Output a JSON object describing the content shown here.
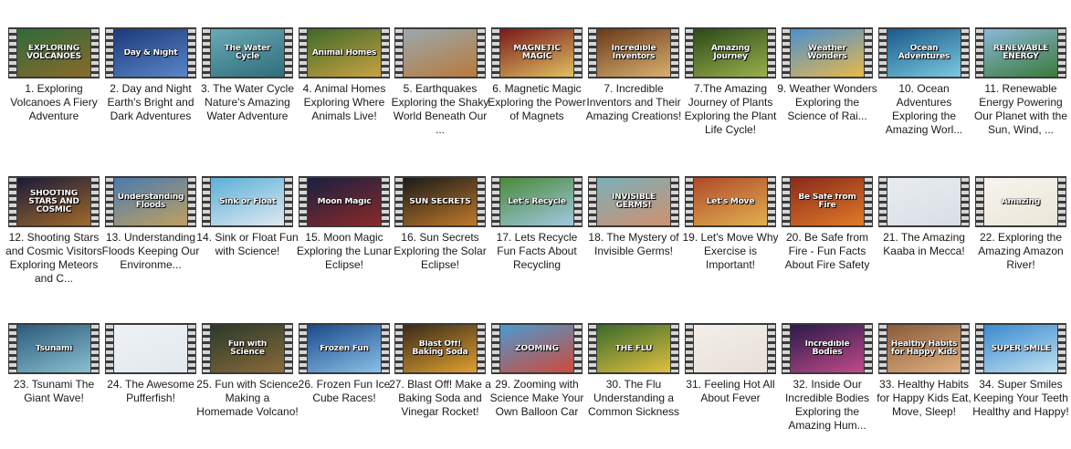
{
  "items": [
    {
      "caption": "1. Exploring Volcanoes A Fiery Adventure",
      "thumb_text": "EXPLORING VOLCANOES",
      "bg": "#2f6b3a",
      "bg2": "#8a6a2a",
      "icon": "video-thumbnail"
    },
    {
      "caption": "2. Day and Night Earth's Bright and Dark Adventures",
      "thumb_text": "Day & Night",
      "bg": "#1c3a7a",
      "bg2": "#5a85c8",
      "icon": "video-thumbnail"
    },
    {
      "caption": "3. The Water Cycle Nature's Amazing Water Adventure",
      "thumb_text": "The Water Cycle",
      "bg": "#6aa9b8",
      "bg2": "#2e6f7a",
      "icon": "video-thumbnail"
    },
    {
      "caption": "4. Animal Homes Exploring Where Animals Live!",
      "thumb_text": "Animal Homes",
      "bg": "#3f6a2a",
      "bg2": "#c9a242",
      "icon": "video-thumbnail"
    },
    {
      "caption": "5. Earthquakes Exploring the Shaky World Beneath Our ...",
      "thumb_text": "",
      "bg": "#9aa8b0",
      "bg2": "#b87a3a",
      "icon": "video-thumbnail"
    },
    {
      "caption": "6. Magnetic Magic Exploring the Power of Magnets",
      "thumb_text": "MAGNETIC MAGIC",
      "bg": "#7a1a1a",
      "bg2": "#e0c060",
      "icon": "video-thumbnail"
    },
    {
      "caption": "7. Incredible Inventors and Their Amazing Creations!",
      "thumb_text": "Incredible Inventors",
      "bg": "#6a3a1a",
      "bg2": "#d9b070",
      "icon": "video-thumbnail"
    },
    {
      "caption": "7.The Amazing Journey of Plants Exploring the Plant Life Cycle!",
      "thumb_text": "Amazing Journey",
      "bg": "#2a4a1a",
      "bg2": "#9ab04a",
      "icon": "video-thumbnail"
    },
    {
      "caption": "9. Weather Wonders Exploring the Science of Rai...",
      "thumb_text": "Weather Wonders",
      "bg": "#4a90d0",
      "bg2": "#e8b84a",
      "icon": "video-thumbnail"
    },
    {
      "caption": "10. Ocean Adventures Exploring the Amazing Worl...",
      "thumb_text": "Ocean Adventures",
      "bg": "#1a5a8a",
      "bg2": "#7ac8e0",
      "icon": "video-thumbnail"
    },
    {
      "caption": "11. Renewable Energy Powering Our Planet with the Sun, Wind, ...",
      "thumb_text": "RENEWABLE ENERGY",
      "bg": "#8ab8d8",
      "bg2": "#3a7a3a",
      "icon": "video-thumbnail"
    },
    {
      "caption": "12. Shooting Stars and Cosmic Visitors Exploring Meteors and C...",
      "thumb_text": "SHOOTING STARS AND COSMIC",
      "bg": "#1a1a3a",
      "bg2": "#a06a2a",
      "icon": "video-thumbnail"
    },
    {
      "caption": "13. Understanding Floods Keeping Our Environme...",
      "thumb_text": "Understanding Floods",
      "bg": "#4a7ab0",
      "bg2": "#c0a060",
      "icon": "video-thumbnail"
    },
    {
      "caption": "14. Sink or Float Fun with Science!",
      "thumb_text": "Sink or Float",
      "bg": "#5ab0d8",
      "bg2": "#e0e8f0",
      "icon": "video-thumbnail"
    },
    {
      "caption": "15. Moon Magic Exploring the Lunar Eclipse!",
      "thumb_text": "Moon Magic",
      "bg": "#1a2040",
      "bg2": "#8a2a2a",
      "icon": "video-thumbnail"
    },
    {
      "caption": "16. Sun Secrets Exploring the Solar Eclipse!",
      "thumb_text": "SUN SECRETS",
      "bg": "#1a1a1a",
      "bg2": "#c07a2a",
      "icon": "video-thumbnail"
    },
    {
      "caption": "17. Lets Recycle Fun Facts About Recycling",
      "thumb_text": "Let's Recycle",
      "bg": "#4a8a3a",
      "bg2": "#a0c8e0",
      "icon": "video-thumbnail"
    },
    {
      "caption": "18. The Mystery of Invisible Germs!",
      "thumb_text": "INVISIBLE GERMS!",
      "bg": "#7ab0b8",
      "bg2": "#d09070",
      "icon": "video-thumbnail"
    },
    {
      "caption": "19. Let's Move Why Exercise is Important!",
      "thumb_text": "Let's Move",
      "bg": "#b04a2a",
      "bg2": "#e0b050",
      "icon": "video-thumbnail"
    },
    {
      "caption": "20. Be Safe from Fire - Fun Facts About Fire Safety",
      "thumb_text": "Be Safe from Fire",
      "bg": "#8a2a1a",
      "bg2": "#e07a2a",
      "icon": "video-thumbnail"
    },
    {
      "caption": "21. The Amazing Kaaba in Mecca!",
      "thumb_text": "",
      "bg": "#e8ecef",
      "bg2": "#d8dfe6",
      "icon": "video-thumbnail"
    },
    {
      "caption": "22. Exploring the Amazing Amazon River!",
      "thumb_text": "Amazing",
      "bg": "#f6f4ee",
      "bg2": "#ece6d8",
      "icon": "video-thumbnail"
    },
    {
      "caption": "23. Tsunami The Giant Wave!",
      "thumb_text": "Tsunami",
      "bg": "#2a5a7a",
      "bg2": "#8ac0d0",
      "icon": "video-thumbnail"
    },
    {
      "caption": "24. The Awesome Pufferfish!",
      "thumb_text": "",
      "bg": "#eef2f5",
      "bg2": "#e2e8ee",
      "icon": "video-thumbnail"
    },
    {
      "caption": "25. Fun with Science Making a Homemade Volcano!",
      "thumb_text": "Fun with Science",
      "bg": "#2a3a2a",
      "bg2": "#8a6a3a",
      "icon": "video-thumbnail"
    },
    {
      "caption": "26. Frozen Fun Ice Cube Races!",
      "thumb_text": "Frozen Fun",
      "bg": "#1a4a8a",
      "bg2": "#8ac0e8",
      "icon": "video-thumbnail"
    },
    {
      "caption": "27. Blast Off! Make a Baking Soda and Vinegar Rocket!",
      "thumb_text": "Blast Off! Baking Soda",
      "bg": "#3a2a1a",
      "bg2": "#e0a030",
      "icon": "video-thumbnail"
    },
    {
      "caption": "29. Zooming with Science Make Your Own Balloon Car",
      "thumb_text": "ZOOMING",
      "bg": "#4a9ad0",
      "bg2": "#d04a3a",
      "icon": "video-thumbnail"
    },
    {
      "caption": "30. The Flu Understanding a Common Sickness",
      "thumb_text": "THE FLU",
      "bg": "#3a6a2a",
      "bg2": "#e0c040",
      "icon": "video-thumbnail"
    },
    {
      "caption": "31. Feeling Hot All About Fever",
      "thumb_text": "",
      "bg": "#f3eeea",
      "bg2": "#e8e0d8",
      "icon": "video-thumbnail"
    },
    {
      "caption": "32. Inside Our Incredible Bodies Exploring the Amazing Hum...",
      "thumb_text": "Incredible Bodies",
      "bg": "#2a1a4a",
      "bg2": "#c04a8a",
      "icon": "video-thumbnail"
    },
    {
      "caption": "33. Healthy Habits for Happy Kids Eat, Move, Sleep!",
      "thumb_text": "Healthy Habits for Happy Kids",
      "bg": "#8a5a3a",
      "bg2": "#e0b080",
      "icon": "video-thumbnail"
    },
    {
      "caption": "34. Super Smiles Keeping Your Teeth Healthy and Happy!",
      "thumb_text": "SUPER SMILE",
      "bg": "#3a8ad0",
      "bg2": "#c0e0f0",
      "icon": "video-thumbnail"
    }
  ]
}
